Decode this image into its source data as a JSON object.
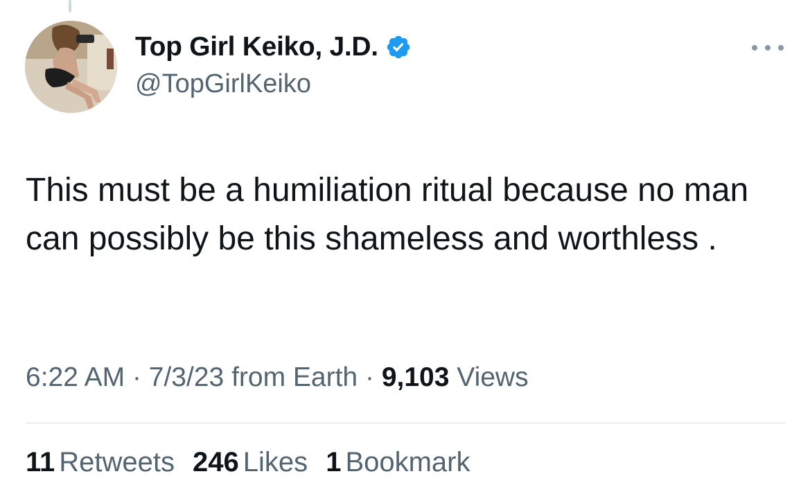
{
  "author": {
    "display_name": "Top Girl Keiko, J.D.",
    "handle": "@TopGirlKeiko",
    "verified": true
  },
  "tweet": {
    "text": "This must be a humiliation ritual because no man can possibly be this shameless and worthless ."
  },
  "meta": {
    "time": "6:22 AM",
    "separator": "·",
    "date": "7/3/23",
    "source": "from Earth",
    "views_count": "9,103",
    "views_label": "Views"
  },
  "stats": [
    {
      "count": "11",
      "label": "Retweets"
    },
    {
      "count": "246",
      "label": "Likes"
    },
    {
      "count": "1",
      "label": "Bookmark"
    }
  ],
  "colors": {
    "text_primary": "#0f1419",
    "text_secondary": "#536471",
    "verified_blue": "#1d9bf0",
    "divider": "#d9dfe3"
  },
  "icons": {
    "verified": "verified-badge-icon",
    "more": "more-options-icon"
  }
}
